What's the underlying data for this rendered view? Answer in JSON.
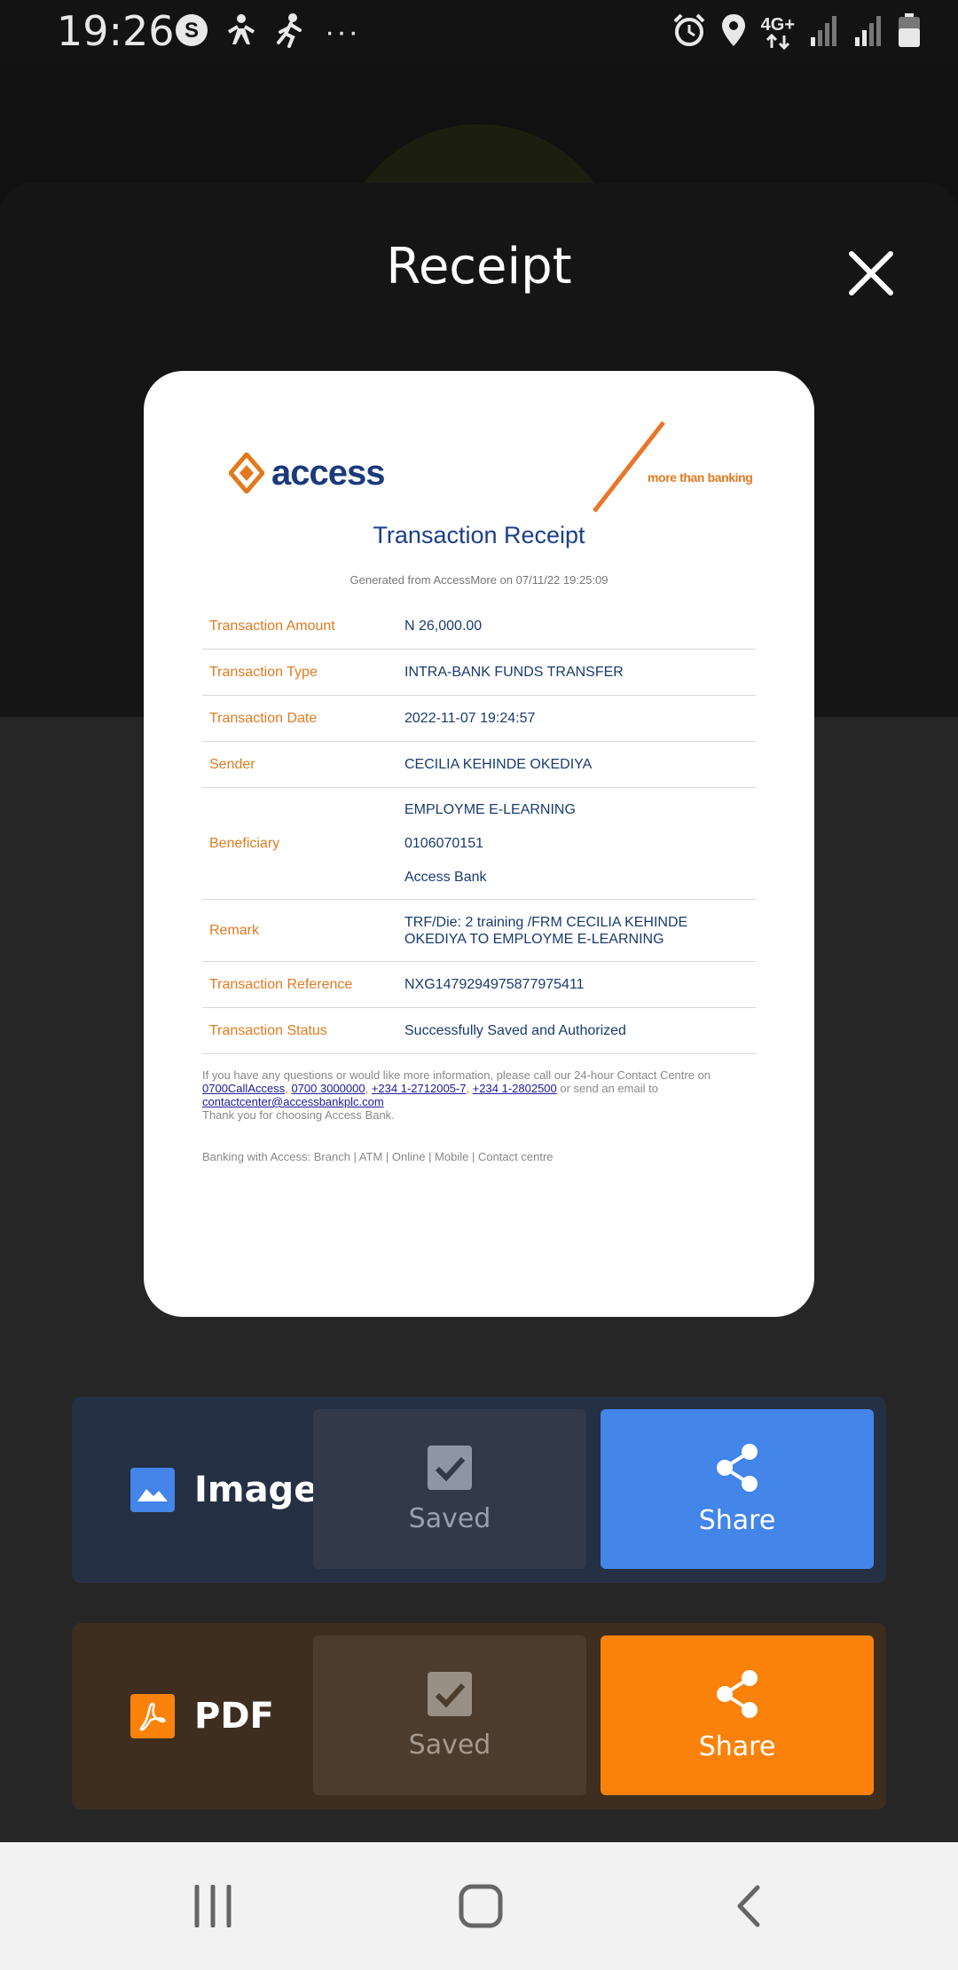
{
  "status_bar": {
    "time": "19:26",
    "network": "4G+",
    "icons": [
      "s-app-icon",
      "person-activity-icon",
      "running-icon",
      "more-dots-icon",
      "alarm-icon",
      "location-icon",
      "network-arrows-icon",
      "signal-icon",
      "signal-icon",
      "battery-icon"
    ]
  },
  "sheet": {
    "title": "Receipt",
    "close_icon": "close-icon"
  },
  "receipt": {
    "brand": "access",
    "tagline": "more than banking",
    "title": "Transaction Receipt",
    "generated": "Generated from AccessMore on 07/11/22 19:25:09",
    "rows": [
      {
        "label": "Transaction Amount",
        "value": "N 26,000.00"
      },
      {
        "label": "Transaction Type",
        "value": "INTRA-BANK FUNDS TRANSFER"
      },
      {
        "label": "Transaction Date",
        "value": "2022-11-07 19:24:57"
      },
      {
        "label": "Sender",
        "value": "CECILIA KEHINDE OKEDIYA"
      },
      {
        "label": "Beneficiary",
        "values": [
          "EMPLOYME E-LEARNING",
          "0106070151",
          "Access Bank"
        ]
      },
      {
        "label": "Remark",
        "values": [
          "TRF/Die: 2 training /FRM CECILIA KEHINDE",
          "OKEDIYA TO EMPLOYME E-LEARNING"
        ]
      },
      {
        "label": "Transaction Reference",
        "value": "NXG1479294975877975411"
      },
      {
        "label": "Transaction Status",
        "value": "Successfully Saved and Authorized"
      }
    ],
    "footer": {
      "intro": "If you have any questions or would like more information, please call our 24-hour Contact Centre on",
      "phone1": "0700CallAccess",
      "phone2": "0700 3000000",
      "phone3": "+234 1-2712005-7",
      "phone4": "+234 1-2802500",
      "or_email": "or send an email to",
      "email": "contactcenter@accessbankplc.com",
      "thanks": "Thank you for choosing Access Bank.",
      "banking": "Banking with Access: Branch | ATM | Online | Mobile | Contact centre"
    }
  },
  "actions": {
    "image": {
      "label": "Image",
      "saved_label": "Saved",
      "share_label": "Share",
      "accent": "#4385e8"
    },
    "pdf": {
      "label": "PDF",
      "saved_label": "Saved",
      "share_label": "Share",
      "accent": "#fb820a"
    }
  },
  "nav": {
    "recents_icon": "recents-icon",
    "home_icon": "home-icon",
    "back_icon": "back-icon"
  }
}
